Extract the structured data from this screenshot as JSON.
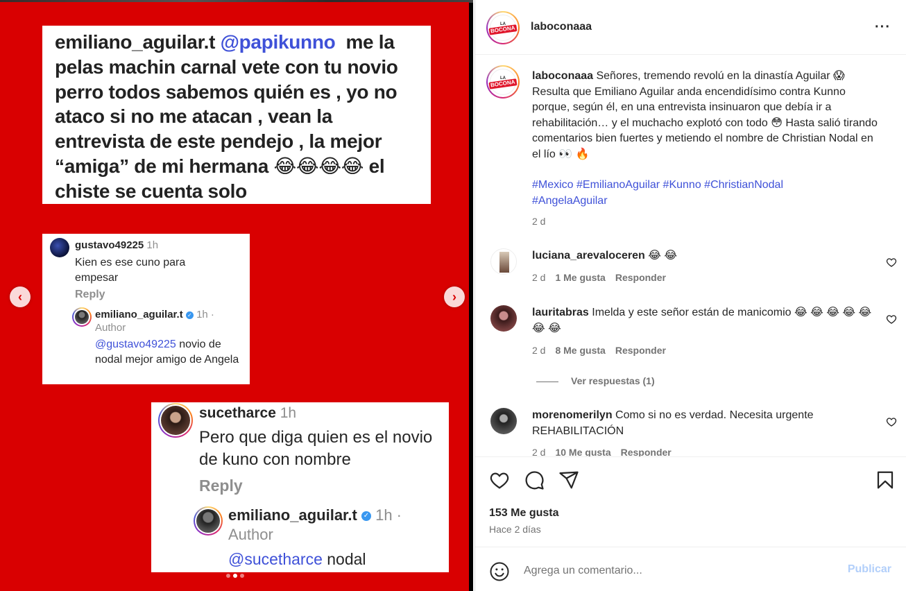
{
  "post": {
    "card_main": {
      "username": "emiliano_aguilar.t",
      "mention": "@papikunno",
      "text_after_mention": "me la pelas machin carnal vete con tu novio perro  todos sabemos quién es , yo no ataco si no me atacan , vean la entrevista de este pendejo , la mejor “amiga” de mi hermana 😂😂😂😂 el chiste se cuenta solo"
    },
    "card_gustavo": {
      "username": "gustavo49225",
      "time": "1h",
      "comment": "Kien es ese cuno para empesar",
      "reply_label": "Reply",
      "reply_user": "emiliano_aguilar.t",
      "reply_time": "1h ·",
      "author_label": "Author",
      "reply_mention": "@gustavo49225",
      "reply_text": "novio de nodal mejor amigo de Angela"
    },
    "card_sucetharce": {
      "username": "sucetharce",
      "time": "1h",
      "comment": "Pero que diga quien es el novio de kuno con nombre",
      "reply_label": "Reply",
      "reply_user": "emiliano_aguilar.t",
      "reply_time": "1h ·",
      "author_label": "Author",
      "reply_mention": "@sucetharce",
      "reply_text": "nodal"
    },
    "nav": {
      "prev": "‹",
      "next": "›"
    }
  },
  "panel": {
    "account": "laboconaaa",
    "logo_top": "LA",
    "logo_bottom": "BOCONA",
    "more": "···",
    "caption_user": "laboconaaa",
    "caption": "Señores, tremendo revolú en la dinastía Aguilar 😱 Resulta que Emiliano Aguilar anda encendidísimo contra Kunno porque, según él, en una entrevista insinuaron que debía ir a rehabilitación… y el muchacho explotó con todo 😳 Hasta salió tirando comentarios bien fuertes y metiendo el nombre de Christian Nodal en el lío 👀 🔥",
    "hashtags": [
      "#Mexico",
      "#EmilianoAguilar",
      "#Kunno",
      "#ChristianNodal",
      "#AngelaAguilar"
    ],
    "caption_time": "2 d",
    "comments": [
      {
        "user": "luciana_arevaloceren",
        "text": "😂 😂",
        "time": "2 d",
        "likes": "1 Me gusta",
        "reply": "Responder"
      },
      {
        "user": "lauritabras",
        "text": "Imelda y este señor están de manicomio 😂 😂 😂 😂 😂 😂 😂",
        "time": "2 d",
        "likes": "8 Me gusta",
        "reply": "Responder",
        "view_replies": "Ver respuestas (1)"
      },
      {
        "user": "morenomerilyn",
        "text": "Como si no es verdad. Necesita urgente REHABILITACIÓN",
        "time": "2 d",
        "likes": "10 Me gusta",
        "reply": "Responder"
      }
    ],
    "likes_total": "153 Me gusta",
    "posted_ago": "Hace 2 días",
    "comment_placeholder": "Agrega un comentario...",
    "publish": "Publicar"
  },
  "colors": {
    "slide_bg": "#d90001",
    "link_blue": "#3f51d8",
    "publish_disabled": "#b2cffa",
    "muted": "#737373"
  },
  "icons": [
    "chevron-left-icon",
    "chevron-right-icon",
    "more-icon",
    "heart-icon",
    "comment-icon",
    "share-icon",
    "bookmark-icon",
    "emoji-icon",
    "verified-icon"
  ]
}
